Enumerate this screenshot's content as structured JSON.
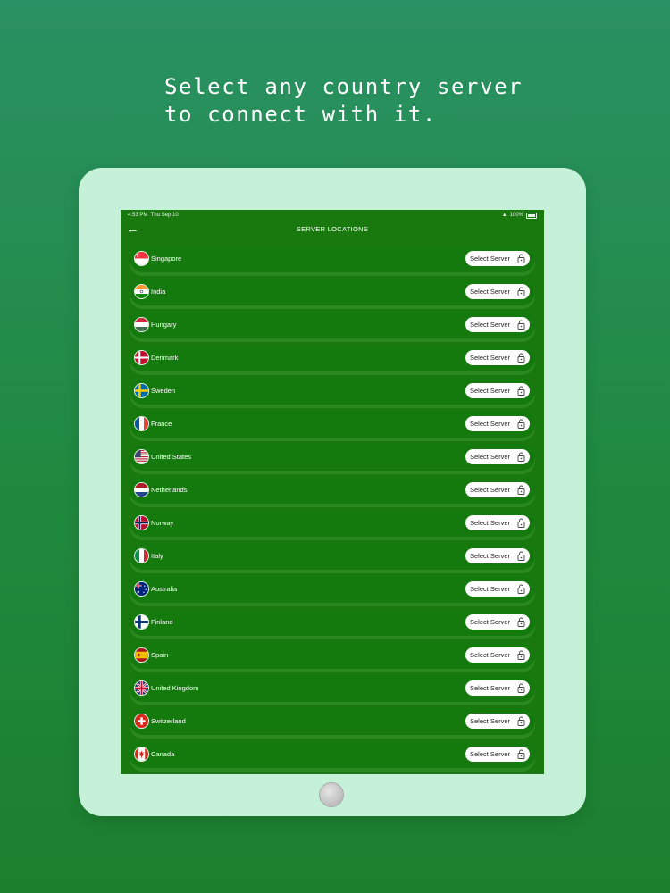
{
  "headline": {
    "line1": "Select any country server",
    "line2": "to connect with it."
  },
  "status_bar": {
    "time": "4:53 PM",
    "date": "Thu Sep 10",
    "battery": "100%"
  },
  "nav": {
    "back_icon": "arrow-left-icon",
    "title": "SERVER LOCATIONS"
  },
  "servers": [
    {
      "name": "Singapore",
      "button": "Select Server"
    },
    {
      "name": "India",
      "button": "Select Server"
    },
    {
      "name": "Hungary",
      "button": "Select Server"
    },
    {
      "name": "Denmark",
      "button": "Select Server"
    },
    {
      "name": "Sweden",
      "button": "Select Server"
    },
    {
      "name": "France",
      "button": "Select Server"
    },
    {
      "name": "United States",
      "button": "Select Server"
    },
    {
      "name": "Netherlands",
      "button": "Select Server"
    },
    {
      "name": "Norway",
      "button": "Select Server"
    },
    {
      "name": "Italy",
      "button": "Select Server"
    },
    {
      "name": "Australia",
      "button": "Select Server"
    },
    {
      "name": "Finland",
      "button": "Select Server"
    },
    {
      "name": "Spain",
      "button": "Select Server"
    },
    {
      "name": "United Kingdom",
      "button": "Select Server"
    },
    {
      "name": "Switzerland",
      "button": "Select Server"
    },
    {
      "name": "Canada",
      "button": "Select Server"
    }
  ],
  "colors": {
    "background": "#22904a",
    "tablet_frame": "#c6f1d9",
    "screen": "#19790f",
    "row": "#157a0e"
  }
}
